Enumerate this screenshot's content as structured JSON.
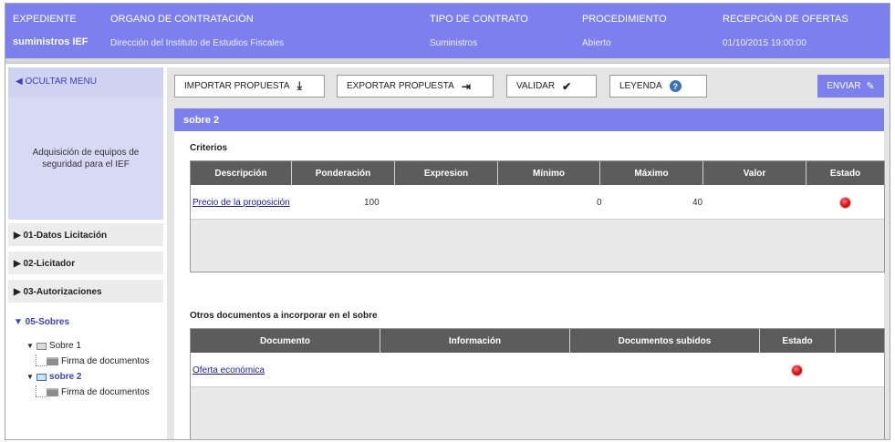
{
  "header": {
    "cols": [
      {
        "label": "EXPEDIENTE",
        "value": "suministros IEF"
      },
      {
        "label": "ORGANO DE CONTRATACIÓN",
        "value": "Dirección del Instituto de Estudios Fiscales"
      },
      {
        "label": "TIPO DE CONTRATO",
        "value": "Suministros"
      },
      {
        "label": "PROCEDIMIENTO",
        "value": "Abierto"
      },
      {
        "label": "RECEPCIÓN DE OFERTAS",
        "value": "01/10/2015 19:00:00"
      }
    ]
  },
  "sidebar": {
    "toggle_label": "◀ OCULTAR MENU",
    "procedure_title": "Adquisición de equipos de seguridad para el IEF",
    "nav": [
      {
        "label": "▶ 01-Datos Licitación"
      },
      {
        "label": "▶ 02-Licitador"
      },
      {
        "label": "▶ 03-Autorizaciones"
      },
      {
        "label": "▼ 05-Sobres"
      }
    ],
    "tree": {
      "sobre1": "Sobre 1",
      "sobre1_child": "Firma de documentos",
      "sobre2": "sobre 2",
      "sobre2_child": "Firma de documentos"
    }
  },
  "toolbar": {
    "import_label": "IMPORTAR PROPUESTA",
    "export_label": "EXPORTAR PROPUESTA",
    "validate_label": "VALIDAR",
    "legend_label": "LEYENDA",
    "send_label": "ENVIAR"
  },
  "panel": {
    "title": "sobre 2",
    "criteria_title": "Criterios",
    "criteria_headers": [
      "Descripción",
      "Ponderación",
      "Expresion",
      "Mínimo",
      "Máximo",
      "Valor",
      "Estado"
    ],
    "criteria_rows": [
      {
        "descripcion": "Precio de la proposición",
        "ponderacion": "100",
        "expresion": "",
        "minimo": "0",
        "maximo": "40",
        "valor": "",
        "estado_color": "#e21b1b"
      }
    ],
    "docs_title": "Otros documentos a incorporar en el sobre",
    "docs_headers": [
      "Documento",
      "Información",
      "Documentos subidos",
      "Estado",
      ""
    ],
    "docs_rows": [
      {
        "documento": "Oferta económica",
        "informacion": "",
        "subidos": "",
        "estado_color": "#e21b1b"
      }
    ]
  },
  "colors": {
    "accent": "#7b80ee",
    "table_header": "#5c5c5c",
    "status_red": "#e21b1b"
  }
}
